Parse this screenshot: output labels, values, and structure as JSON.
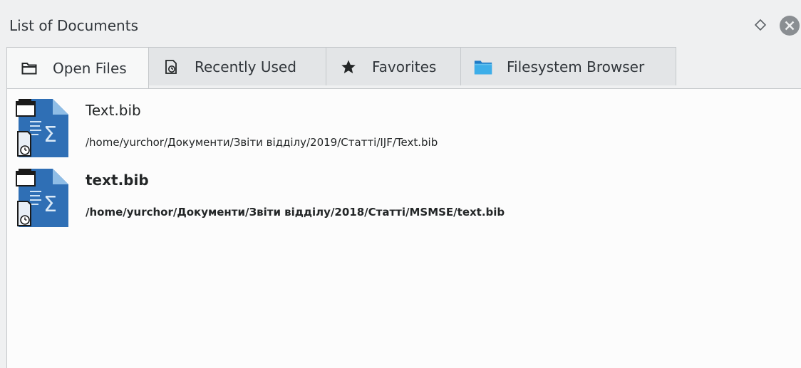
{
  "panel": {
    "title": "List of Documents"
  },
  "tabs": [
    {
      "label": "Open Files",
      "icon": "folder-outline-icon",
      "active": true
    },
    {
      "label": "Recently Used",
      "icon": "recent-document-icon",
      "active": false
    },
    {
      "label": "Favorites",
      "icon": "star-icon",
      "active": false
    },
    {
      "label": "Filesystem Browser",
      "icon": "blue-folder-icon",
      "active": false
    }
  ],
  "documents": [
    {
      "name": "Text.bib",
      "path": "/home/yurchor/Документи/Звіти відділу/2019/Статті/IJF/Text.bib",
      "icon": "bibtex-file-icon",
      "bold": false
    },
    {
      "name": "text.bib",
      "path": "/home/yurchor/Документи/Звіти відділу/2018/Статті/MSMSE/text.bib",
      "icon": "bibtex-file-icon",
      "bold": true
    }
  ],
  "colors": {
    "accent": "#3daee9",
    "file_icon": "#2f6fb5",
    "background": "#eff0f1"
  }
}
